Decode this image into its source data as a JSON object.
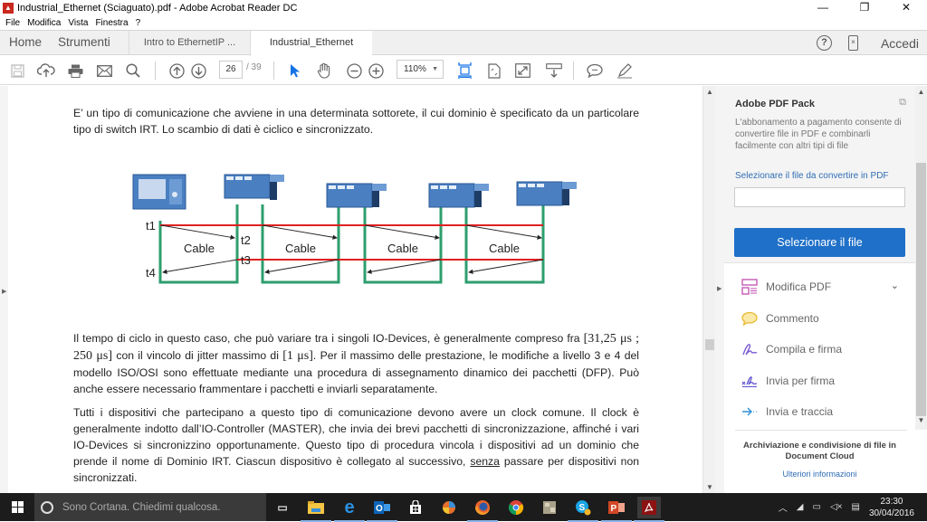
{
  "window": {
    "title": "Industrial_Ethernet (Sciaguato).pdf - Adobe Acrobat Reader DC",
    "controls": {
      "minimize": "—",
      "restore": "❐",
      "close": "✕"
    }
  },
  "menu": [
    "File",
    "Modifica",
    "Vista",
    "Finestra",
    "?"
  ],
  "tabs": {
    "home": "Home",
    "tools": "Strumenti",
    "documents": [
      {
        "label": "Intro to EthernetIP ...",
        "active": false
      },
      {
        "label": "Industrial_Ethernet ...",
        "active": true,
        "close": "×"
      }
    ],
    "signin": "Accedi",
    "help_icon": "?",
    "mobile_icon": "×"
  },
  "toolbar": {
    "icons": [
      "save-icon",
      "upload-cloud-icon",
      "print-icon",
      "mail-icon",
      "search-icon",
      "page-up-icon",
      "page-down-icon",
      "select-cursor-icon",
      "hand-icon",
      "zoom-out-icon",
      "zoom-in-icon",
      "fit-page-icon",
      "rotate-icon",
      "fullscreen-icon",
      "scroll-mode-icon",
      "comment-icon",
      "highlight-pen-icon"
    ],
    "page_current": "26",
    "page_total": "/ 39",
    "zoom": "110%"
  },
  "document": {
    "para1": "E’ un tipo di comunicazione che avviene in una determinata sottorete, il cui dominio è specificato da un particolare tipo di switch IRT. Lo scambio di dati è ciclico e sincronizzato.",
    "diagram": {
      "labels": {
        "t1": "t1",
        "t2": "t2",
        "t3": "t3",
        "t4": "t4"
      },
      "cable_label": "Cable",
      "segments": 4,
      "colors": {
        "cable": "#2e9e6e",
        "sync_line": "#e02020",
        "device": "#4a7fc1"
      }
    },
    "para2_a": "Il tempo di ciclo in questo caso, che può variare tra i singoli IO-Devices, è generalmente compreso fra ",
    "para2_range": "[31,25 μs ; 250 μs]",
    "para2_b": " con il vincolo di jitter massimo di ",
    "para2_jitter": "[1 μs]",
    "para2_c": ". Per il massimo delle prestazione, le modifiche a livello 3 e 4 del modello ISO/OSI sono effettuate mediante una procedura di assegnamento dinamico dei pacchetti (DFP). Può anche essere necessario frammentare i pacchetti e inviarli separatamente.",
    "para3_a": "Tutti i dispositivi che partecipano a questo tipo di comunicazione devono avere un clock comune. Il clock è generalmente indotto dall’IO-Controller (MASTER), che invia dei brevi pacchetti di sincronizzazione, affinché i vari IO-Devices si sincronizzino opportunamente. Questo tipo di procedura vincola i dispositivi ad un dominio che prende il nome di Dominio IRT. Ciascun dispositivo è collegato al successivo, ",
    "para3_u": "senza",
    "para3_b": " passare per dispositivi non sincronizzati."
  },
  "panel": {
    "pack_title": "Adobe PDF Pack",
    "pack_desc": "L'abbonamento a pagamento consente di convertire file in PDF e combinarli facilmente con altri tipi di file",
    "select_link": "Selezionare il file da convertire in PDF",
    "file_input_value": "",
    "select_button": "Selezionare il file",
    "tools": [
      {
        "label": "Modifica PDF",
        "icon": "edit-pdf-icon",
        "color": "#c04fb0",
        "expand": "⌄"
      },
      {
        "label": "Commento",
        "icon": "comment-icon",
        "color": "#e8b830"
      },
      {
        "label": "Compila e firma",
        "icon": "fill-sign-icon",
        "color": "#7b5cd6"
      },
      {
        "label": "Invia per firma",
        "icon": "send-sign-icon",
        "color": "#5b4fcf"
      },
      {
        "label": "Invia e traccia",
        "icon": "send-track-icon",
        "color": "#2e8fd6"
      }
    ],
    "cloud_text": "Archiviazione e condivisione di file in Document Cloud",
    "more_link": "Ulteriori informazioni"
  },
  "taskbar": {
    "search_placeholder": "Sono Cortana. Chiedimi qualcosa.",
    "apps": [
      "task-view",
      "file-explorer",
      "edge",
      "outlook",
      "store",
      "app-circle",
      "firefox",
      "chrome",
      "app-grey",
      "skype",
      "powerpoint",
      "acrobat"
    ],
    "time": "23:30",
    "date": "30/04/2016",
    "tray_icons": [
      "show-hidden-icon",
      "wifi-icon",
      "battery-icon",
      "volume-muted-icon",
      "notifications-icon"
    ]
  }
}
